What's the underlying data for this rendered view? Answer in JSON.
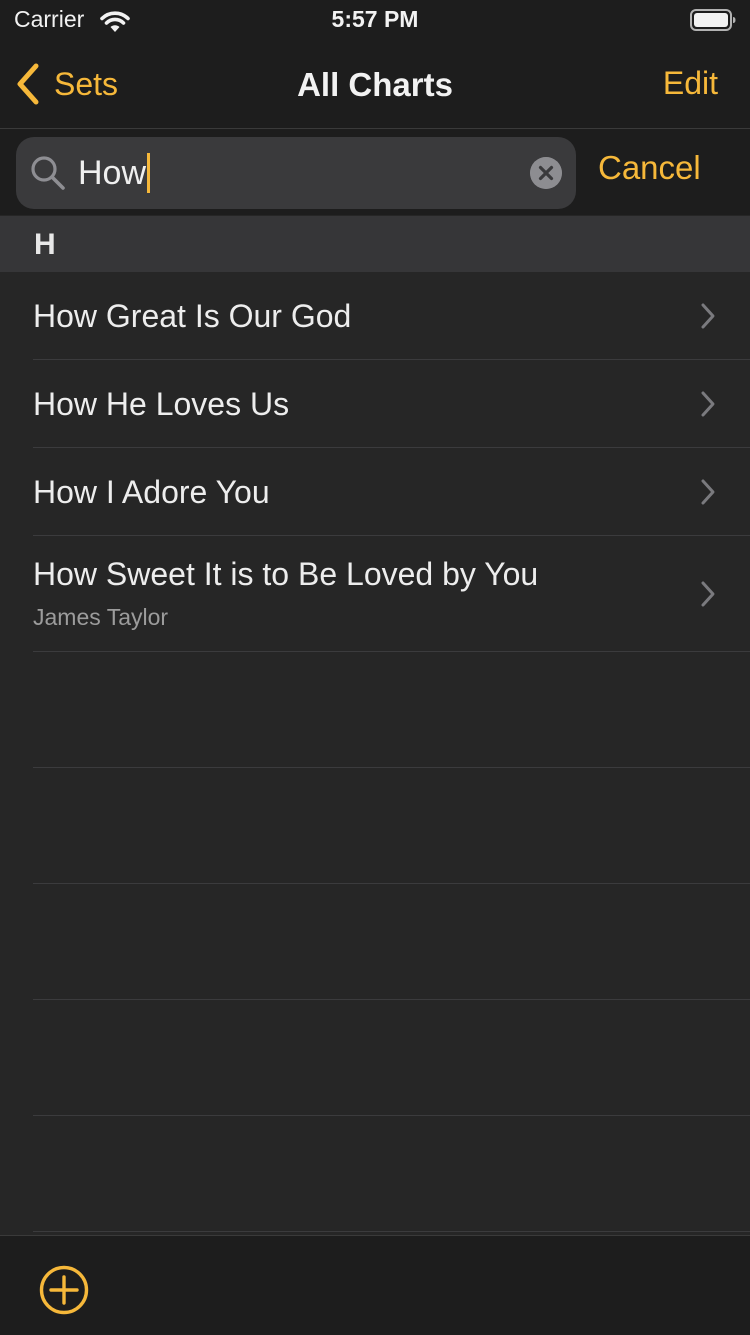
{
  "status_bar": {
    "carrier": "Carrier",
    "time": "5:57 PM"
  },
  "nav": {
    "back_label": "Sets",
    "title": "All Charts",
    "edit_label": "Edit"
  },
  "search": {
    "value": "How",
    "cancel_label": "Cancel"
  },
  "section": {
    "title": "H"
  },
  "charts": [
    {
      "title": "How Great Is Our God",
      "subtitle": ""
    },
    {
      "title": "How He Loves Us",
      "subtitle": ""
    },
    {
      "title": "How I Adore You",
      "subtitle": ""
    },
    {
      "title": "How Sweet It is to Be Loved by You",
      "subtitle": "James Taylor"
    }
  ],
  "colors": {
    "accent": "#f6b83a",
    "background": "#262626",
    "bar": "#1d1d1d"
  }
}
